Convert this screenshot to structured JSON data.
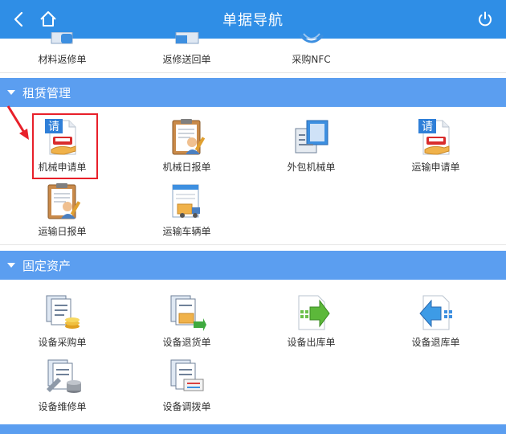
{
  "header": {
    "title": "单据导航",
    "back_icon": "back-icon",
    "home_icon": "home-icon",
    "power_icon": "power-icon",
    "bg_color": "#2f8ee6"
  },
  "top_row": [
    {
      "label": "材料返修单",
      "icon": "repair-doc-icon"
    },
    {
      "label": "返修送回单",
      "icon": "return-doc-icon"
    },
    {
      "label": "采购NFC",
      "icon": "nfc-icon"
    }
  ],
  "sections": [
    {
      "title": "租赁管理",
      "rows": [
        [
          {
            "label": "机械申请单",
            "icon": "request-form-icon",
            "selected": true
          },
          {
            "label": "机械日报单",
            "icon": "clipboard-report-icon"
          },
          {
            "label": "外包机械单",
            "icon": "outsource-doc-icon"
          },
          {
            "label": "运输申请单",
            "icon": "request-form-icon"
          }
        ],
        [
          {
            "label": "运输日报单",
            "icon": "clipboard-report-icon"
          },
          {
            "label": "运输车辆单",
            "icon": "truck-doc-icon"
          }
        ]
      ]
    },
    {
      "title": "固定资产",
      "rows": [
        [
          {
            "label": "设备采购单",
            "icon": "purchase-coins-icon"
          },
          {
            "label": "设备退货单",
            "icon": "return-goods-icon"
          },
          {
            "label": "设备出库单",
            "icon": "outbound-arrow-icon"
          },
          {
            "label": "设备退库单",
            "icon": "inbound-arrow-icon"
          }
        ],
        [
          {
            "label": "设备维修单",
            "icon": "maintenance-icon"
          },
          {
            "label": "设备调拨单",
            "icon": "transfer-doc-icon"
          }
        ]
      ]
    }
  ],
  "colors": {
    "section_bg": "#5b9ef0",
    "highlight": "#e8202a"
  }
}
